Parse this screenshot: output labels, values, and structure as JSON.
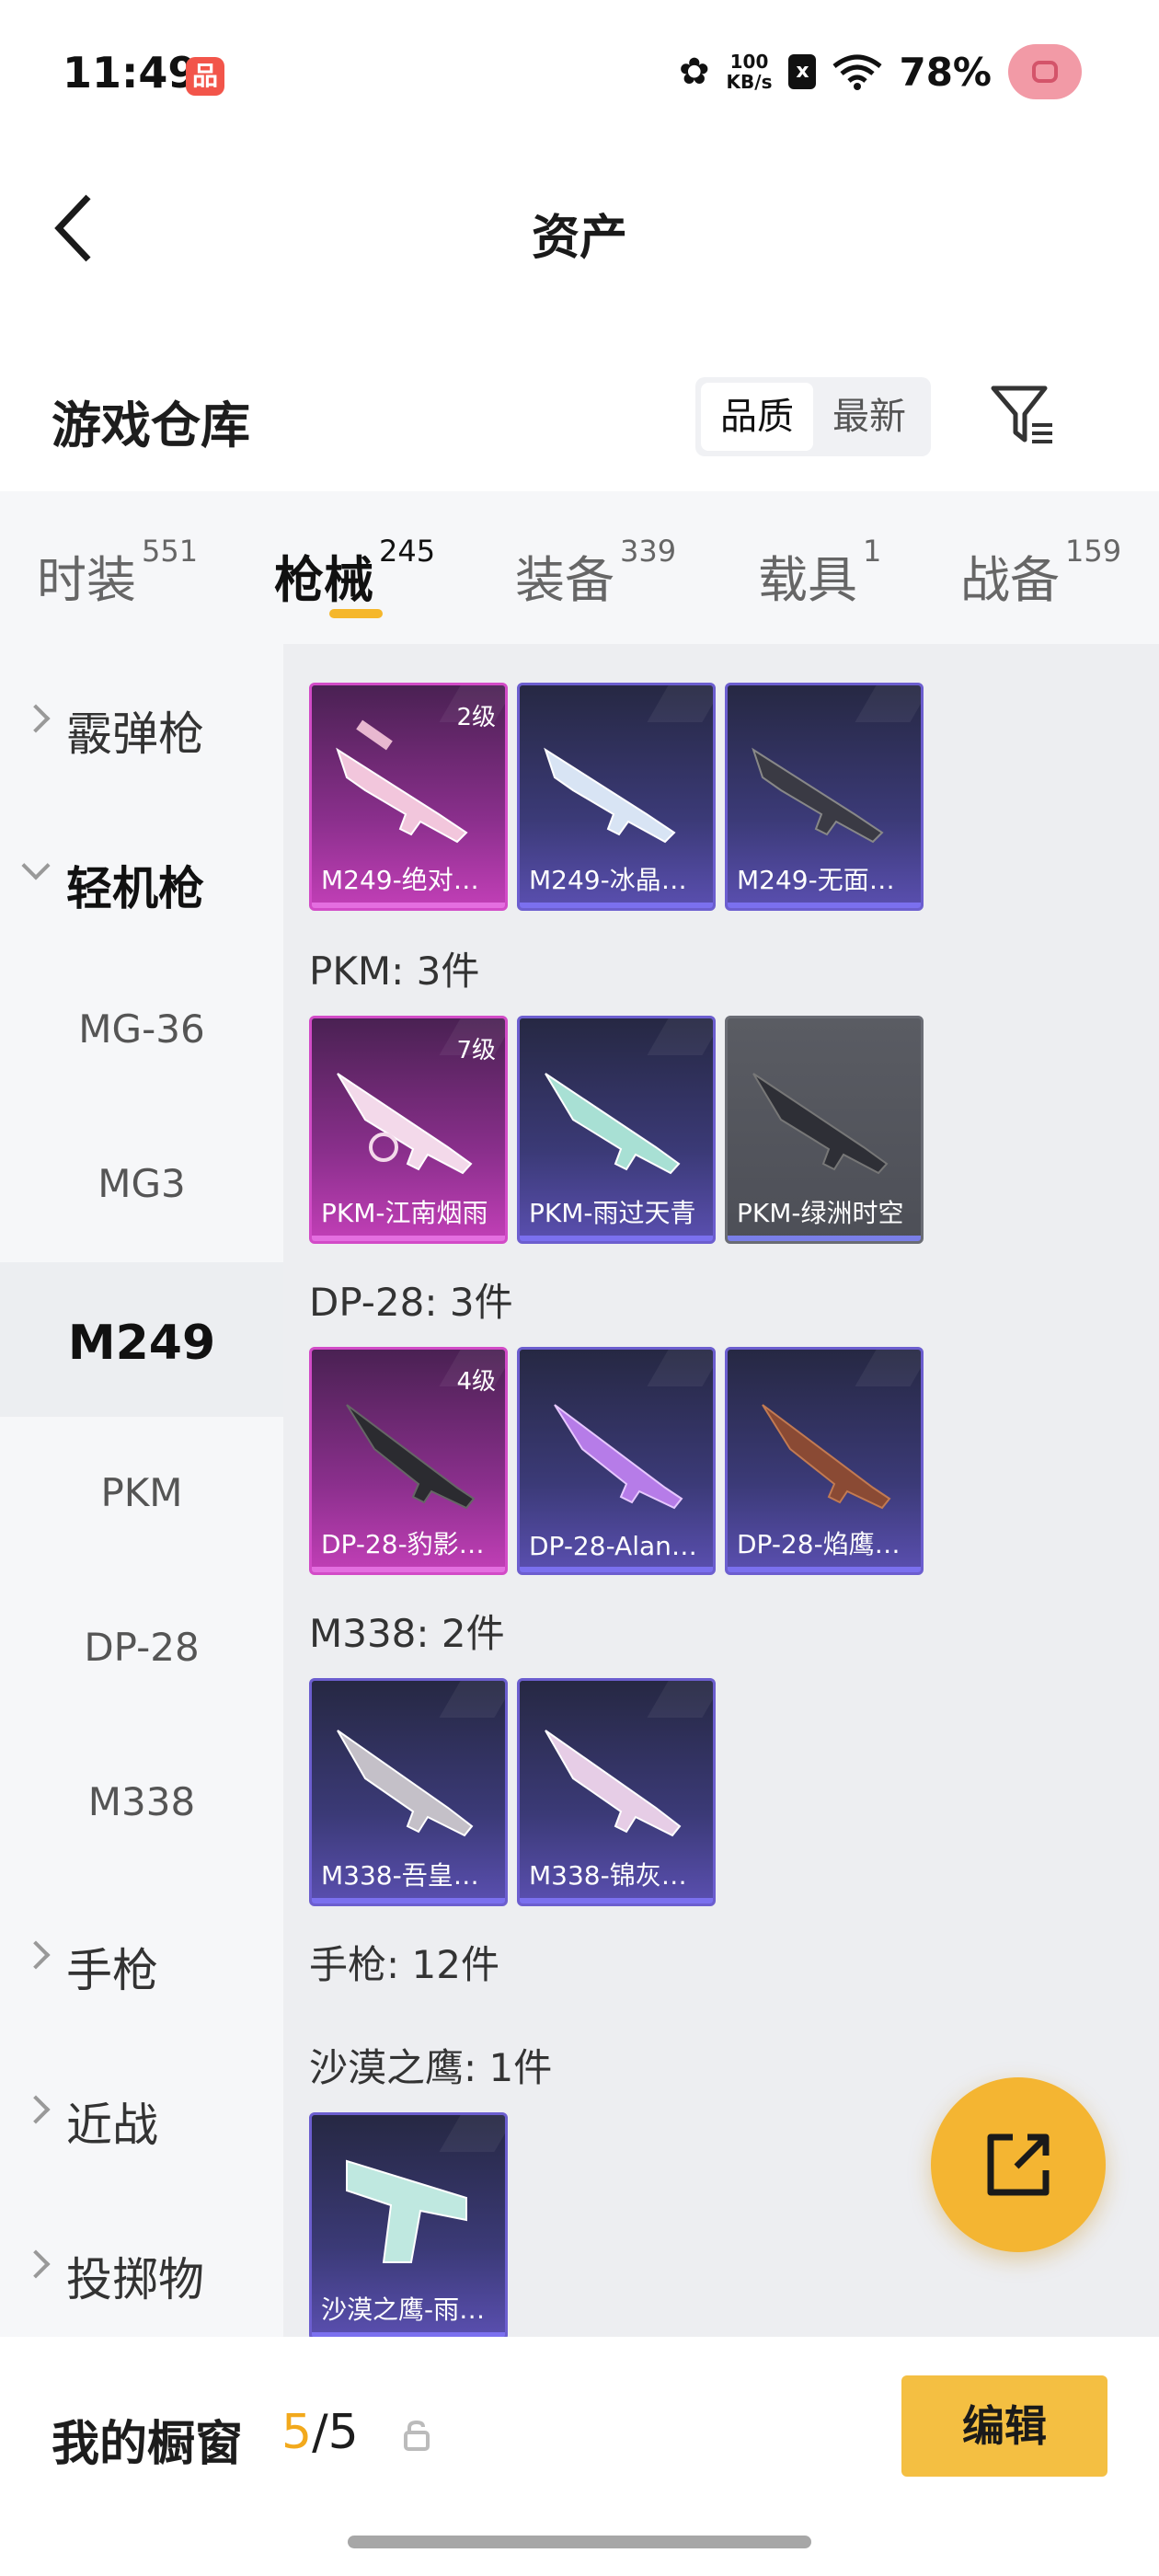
{
  "status_bar": {
    "time": "11:49",
    "app_badge": "品",
    "net_speed_value": "100",
    "net_speed_unit": "KB/s",
    "sim_icon": "x",
    "battery": "78%"
  },
  "nav": {
    "title": "资产"
  },
  "header": {
    "title": "游戏仓库",
    "sort_options": [
      "品质",
      "最新"
    ],
    "active_sort": "品质"
  },
  "categories": [
    {
      "label": "时装",
      "count": "551"
    },
    {
      "label": "枪械",
      "count": "245",
      "active": true
    },
    {
      "label": "装备",
      "count": "339"
    },
    {
      "label": "载具",
      "count": "1"
    },
    {
      "label": "战备",
      "count": "159"
    }
  ],
  "sidebar": {
    "items": [
      {
        "label": "霰弹枪",
        "type": "group"
      },
      {
        "label": "轻机枪",
        "type": "group",
        "open": true
      },
      {
        "label": "MG-36"
      },
      {
        "label": "MG3"
      },
      {
        "label": "M249",
        "selected": true
      },
      {
        "label": "PKM"
      },
      {
        "label": "DP-28"
      },
      {
        "label": "M338"
      },
      {
        "label": "手枪",
        "type": "group"
      },
      {
        "label": "近战",
        "type": "group"
      },
      {
        "label": "投掷物",
        "type": "group"
      }
    ]
  },
  "content": {
    "sections": [
      {
        "title": "",
        "items": [
          {
            "name": "M249-绝对…",
            "level": "2级",
            "rarity": "pink"
          },
          {
            "name": "M249-冰晶…",
            "rarity": "purple"
          },
          {
            "name": "M249-无面…",
            "rarity": "purple"
          }
        ]
      },
      {
        "title": "PKM: 3件",
        "items": [
          {
            "name": "PKM-江南烟雨",
            "level": "7级",
            "rarity": "pink"
          },
          {
            "name": "PKM-雨过天青",
            "rarity": "purple"
          },
          {
            "name": "PKM-绿洲时空",
            "rarity": "gray"
          }
        ]
      },
      {
        "title": "DP-28: 3件",
        "items": [
          {
            "name": "DP-28-豹影…",
            "level": "4级",
            "rarity": "pink"
          },
          {
            "name": "DP-28-Alan…",
            "rarity": "purple"
          },
          {
            "name": "DP-28-焰鹰…",
            "rarity": "purple"
          }
        ]
      },
      {
        "title": "M338: 2件",
        "items": [
          {
            "name": "M338-吾皇…",
            "rarity": "purple"
          },
          {
            "name": "M338-锦灰…",
            "rarity": "purple"
          }
        ]
      },
      {
        "title": "手枪: 12件",
        "items": []
      },
      {
        "title": "沙漠之鹰: 1件",
        "items": [
          {
            "name": "沙漠之鹰-雨…",
            "rarity": "purple"
          }
        ]
      }
    ]
  },
  "bottom": {
    "label": "我的橱窗",
    "current": "5",
    "separator": "/",
    "total": "5",
    "edit_label": "编辑"
  },
  "colors": {
    "accent": "#f4bf42",
    "rare_pink": "#d24bc7",
    "rare_purple": "#6c5ecf"
  }
}
